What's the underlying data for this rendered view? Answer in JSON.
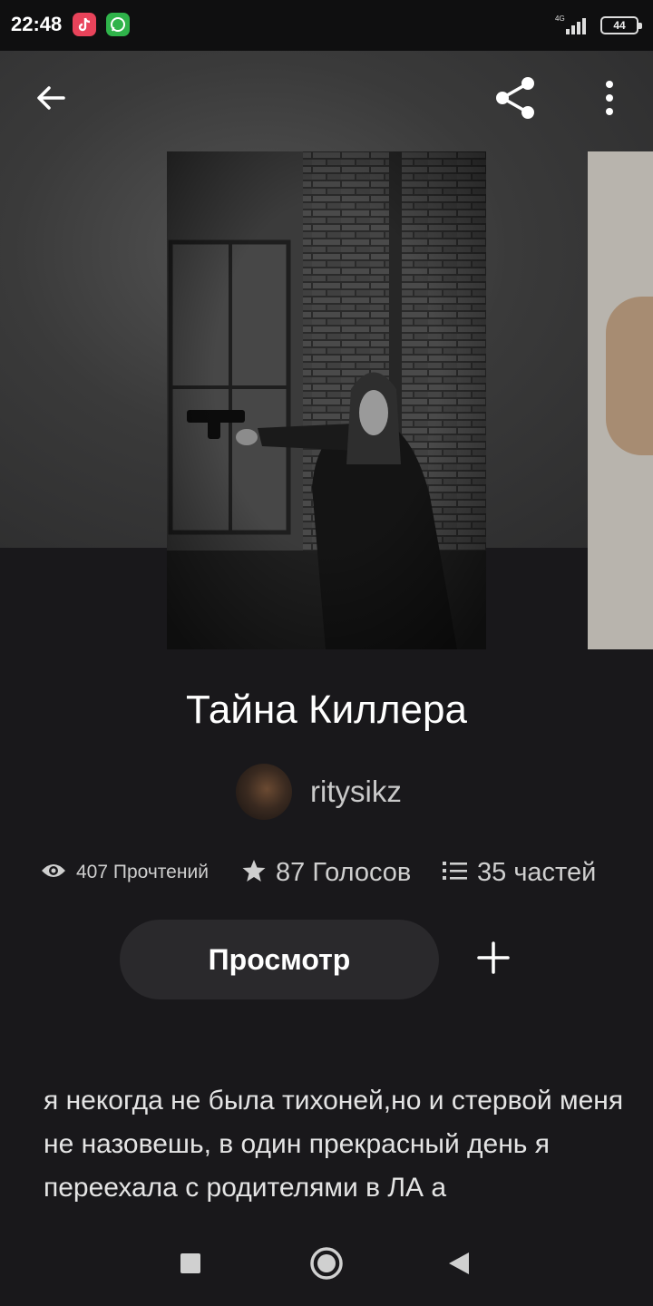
{
  "status_bar": {
    "time": "22:48",
    "network": "4G",
    "battery": "44",
    "apps": [
      "tiktok-icon",
      "whatsapp-icon"
    ]
  },
  "toolbar": {
    "back_icon": "arrow-left-icon",
    "share_icon": "share-icon",
    "more_icon": "more-vertical-icon"
  },
  "story": {
    "title": "Тайна Киллера",
    "author": "ritysikz",
    "stats": {
      "reads": "407 Прочтений",
      "votes": "87 Голосов",
      "parts": "35 частей"
    },
    "view_button": "Просмотр",
    "add_icon": "plus-icon",
    "description": "я некогда не была  тихоней,но и стервой меня не назовешь, в один прекрасный день я переехала с родителями в ЛА а"
  },
  "nav": {
    "icons": [
      "recents-square-icon",
      "home-circle-icon",
      "back-triangle-icon"
    ]
  },
  "colors": {
    "background": "#19181b",
    "button_bg": "#2a292c",
    "text_muted": "#cfcfcf"
  }
}
